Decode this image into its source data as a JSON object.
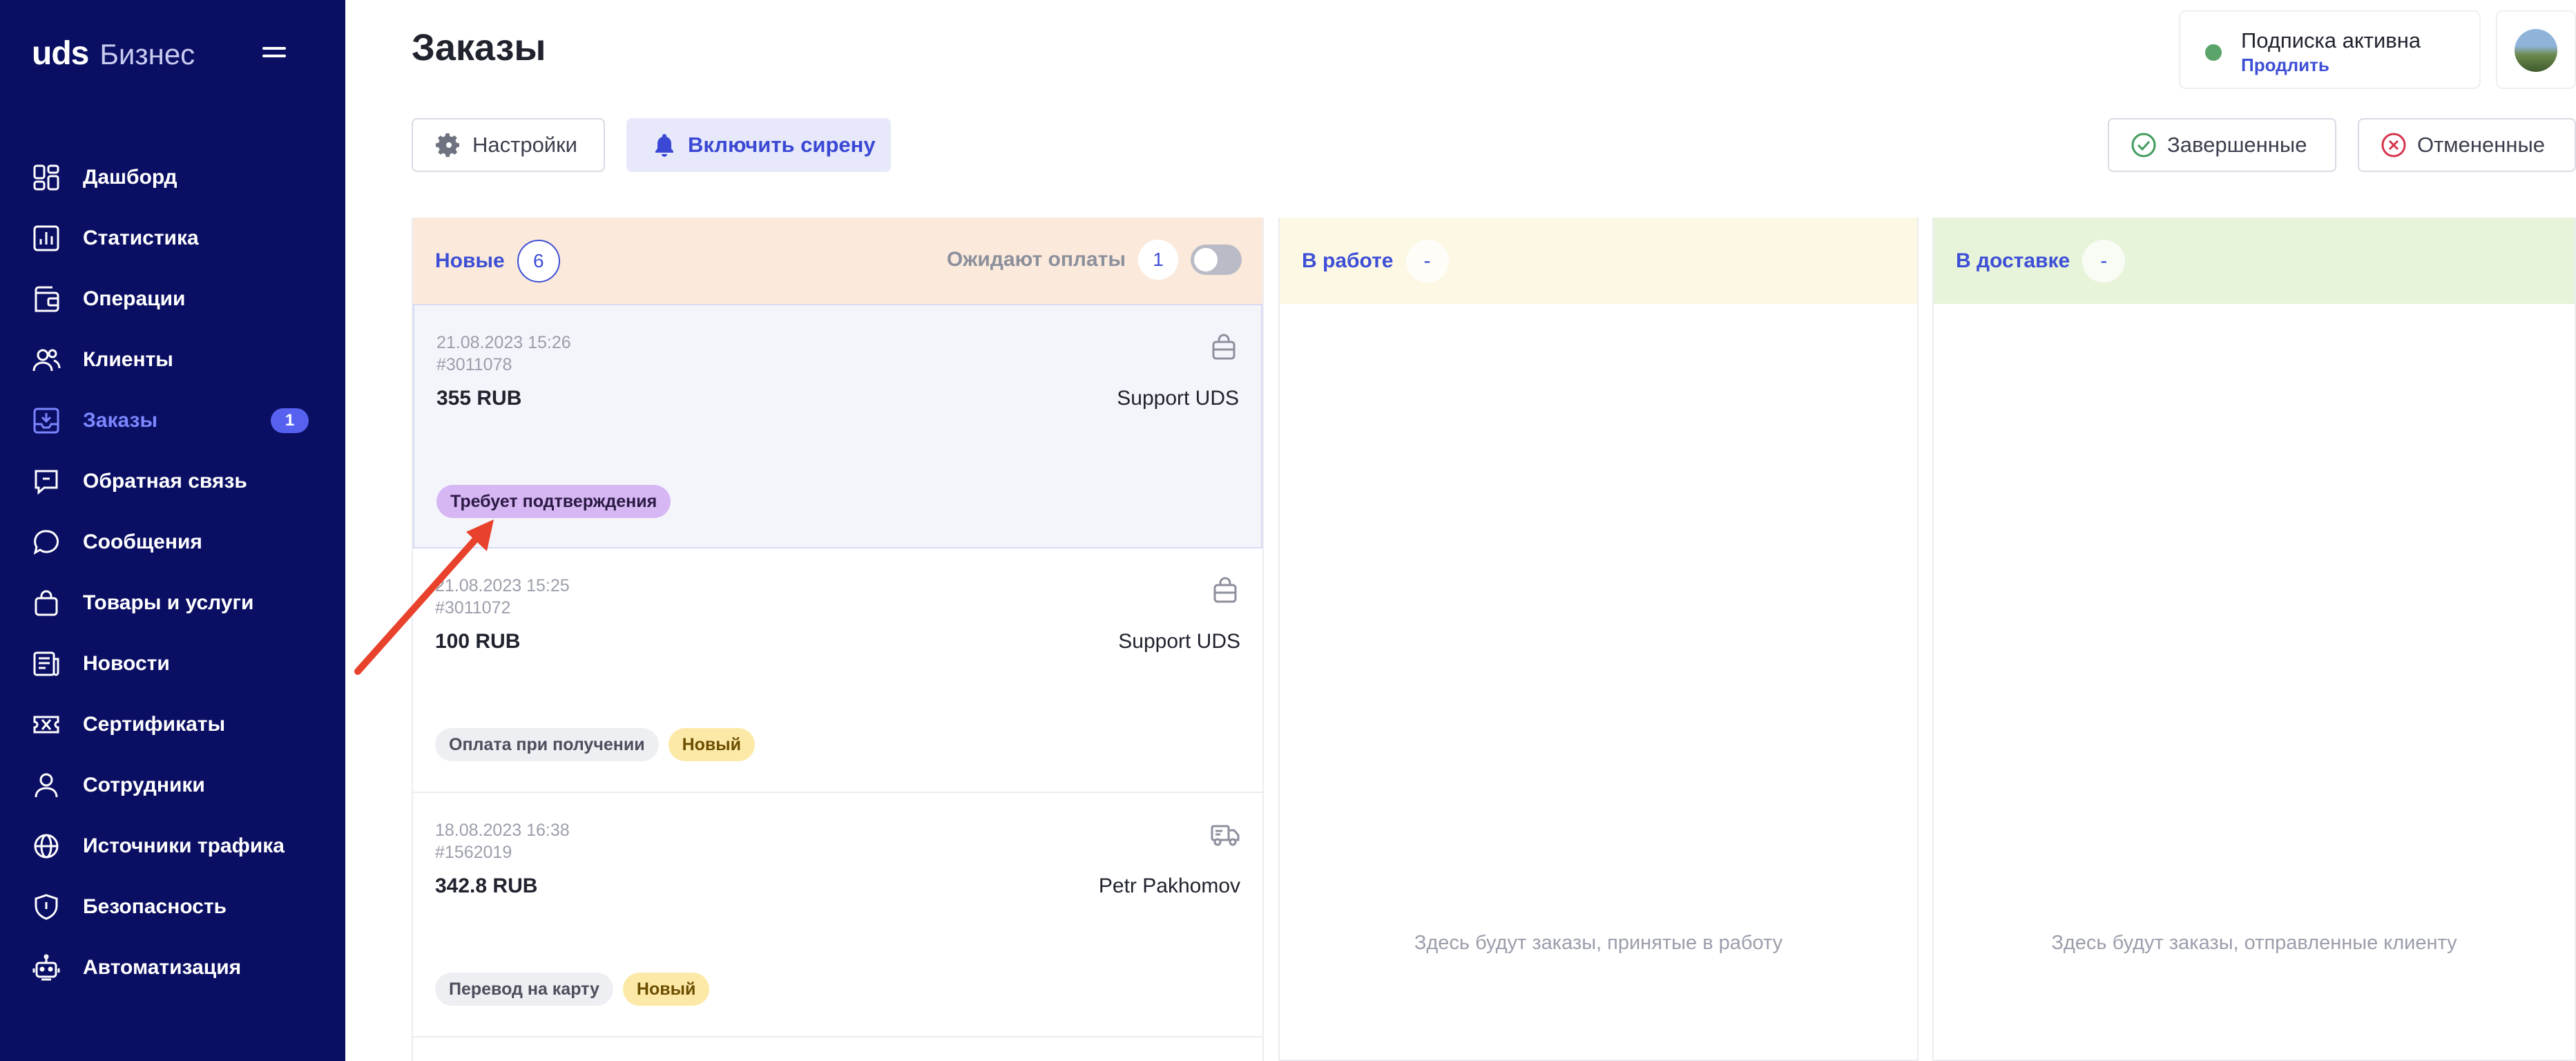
{
  "brand": {
    "primary": "uds",
    "secondary": "Бизнес"
  },
  "sidebar": {
    "items": [
      {
        "label": "Дашборд",
        "icon": "dashboard-icon"
      },
      {
        "label": "Статистика",
        "icon": "chart-icon"
      },
      {
        "label": "Операции",
        "icon": "wallet-icon"
      },
      {
        "label": "Клиенты",
        "icon": "users-icon"
      },
      {
        "label": "Заказы",
        "icon": "inbox-icon",
        "badge": "1",
        "active": true
      },
      {
        "label": "Обратная связь",
        "icon": "feedback-icon"
      },
      {
        "label": "Сообщения",
        "icon": "chat-icon"
      },
      {
        "label": "Товары и услуги",
        "icon": "bag-icon"
      },
      {
        "label": "Новости",
        "icon": "news-icon"
      },
      {
        "label": "Сертификаты",
        "icon": "ticket-icon"
      },
      {
        "label": "Сотрудники",
        "icon": "person-icon"
      },
      {
        "label": "Источники трафика",
        "icon": "globe-icon"
      },
      {
        "label": "Безопасность",
        "icon": "shield-icon"
      },
      {
        "label": "Автоматизация",
        "icon": "robot-icon"
      }
    ]
  },
  "header": {
    "title": "Заказы",
    "subscription": {
      "status": "Подписка активна",
      "action": "Продлить",
      "status_color": "#5aa469"
    }
  },
  "toolbar": {
    "settings": "Настройки",
    "siren": "Включить сирену",
    "completed": "Завершенные",
    "cancelled": "Отмененные"
  },
  "columns": {
    "new": {
      "title": "Новые",
      "count": "6",
      "awaiting_label": "Ожидают оплаты",
      "awaiting_count": "1",
      "awaiting_toggle_on": false
    },
    "in_work": {
      "title": "В работе",
      "count": "-",
      "empty": "Здесь будут заказы, принятые в работу"
    },
    "delivery": {
      "title": "В доставке",
      "count": "-",
      "empty": "Здесь будут заказы, отправленные клиенту"
    }
  },
  "orders": [
    {
      "date": "21.08.2023 15:26",
      "id": "#3011078",
      "sum": "355 RUB",
      "client": "Support UDS",
      "icon": "bag-icon",
      "tags": [
        {
          "text": "Требует подтверждения",
          "style": "purple"
        }
      ]
    },
    {
      "date": "21.08.2023 15:25",
      "id": "#3011072",
      "sum": "100 RUB",
      "client": "Support UDS",
      "icon": "bag-icon",
      "tags": [
        {
          "text": "Оплата при получении",
          "style": "gray"
        },
        {
          "text": "Новый",
          "style": "yellow"
        }
      ]
    },
    {
      "date": "18.08.2023 16:38",
      "id": "#1562019",
      "sum": "342.8 RUB",
      "client": "Petr Pakhomov",
      "icon": "delivery-truck-icon",
      "tags": [
        {
          "text": "Перевод на карту",
          "style": "gray"
        },
        {
          "text": "Новый",
          "style": "yellow"
        }
      ]
    }
  ],
  "colors": {
    "sidebar": "#0b0f63",
    "accent": "#3d4fd6",
    "annotation_arrow": "#e8412c"
  }
}
